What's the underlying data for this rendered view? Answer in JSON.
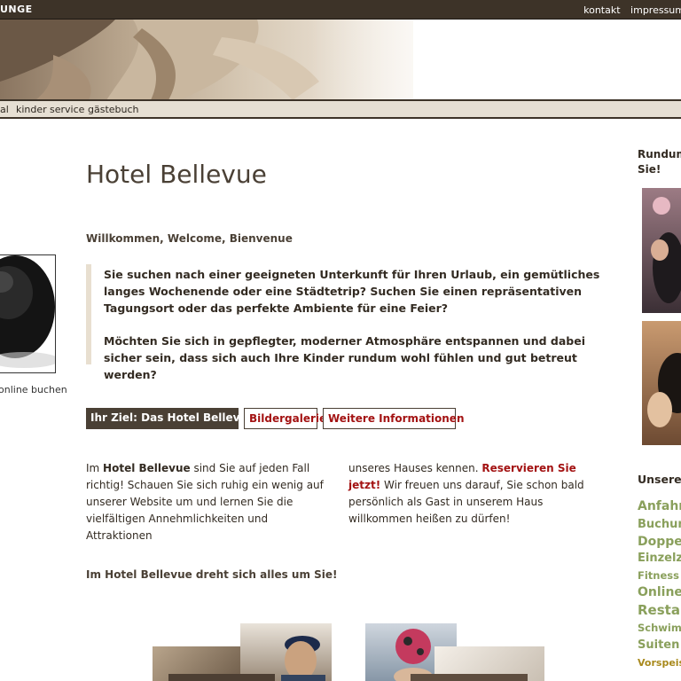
{
  "header": {
    "brand": "UNGE",
    "links": [
      "kontakt",
      "impressum"
    ]
  },
  "nav": {
    "items": [
      "al",
      "kinder",
      "service",
      "gästebuch"
    ]
  },
  "left": {
    "caption": "online buchen"
  },
  "main": {
    "title": "Hotel Bellevue",
    "welcome": "Willkommen, Welcome, Bienvenue",
    "intro_1": "Sie suchen nach einer geeigneten Unterkunft für Ihren Urlaub, ein gemütliches langes Wochenende oder eine Städtetrip? Suchen Sie einen repräsentativen Tagungsort oder das perfekte Ambiente für eine Feier?",
    "intro_2": "Möchten Sie sich in gepflegter, moderner Atmosphäre entspannen und dabei sicher sein, dass sich auch Ihre Kinder rundum wohl fühlen und gut betreut werden?",
    "tabs": [
      "Ihr Ziel: Das Hotel Bellevue",
      "Bildergalerie",
      "Weitere Informationen"
    ],
    "col_a": {
      "pre": "Im ",
      "bold": "Hotel Bellevue",
      "post": " sind Sie auf jeden Fall richtig! Schauen Sie sich ruhig ein wenig auf unserer Website um und lernen Sie die vielfältigen Annehmlichkeiten und Attraktionen"
    },
    "col_b": {
      "pre": "unseres Hauses kennen. ",
      "link": "Reservieren Sie jetzt!",
      "post": " Wir freuen uns darauf, Sie schon bald persönlich als Gast in unserem Haus willkommen heißen zu dürfen!"
    },
    "subheading": "Im Hotel Bellevue dreht sich alles um Sie!"
  },
  "right": {
    "title_1": "Rundum",
    "title_2": "Sie!",
    "unsere": "Unsere",
    "links": [
      "Anfahrt",
      "Buchung",
      "Doppel",
      "Einzelzi",
      "Fitness o",
      "Online",
      "Restau",
      "Schwimm",
      "Suiten",
      "Vorspeis"
    ]
  },
  "colors": {
    "dark_brown": "#3d3328",
    "accent_red": "#a31212",
    "link_green": "#8aa05c",
    "quote_border": "#e8dfd0"
  }
}
